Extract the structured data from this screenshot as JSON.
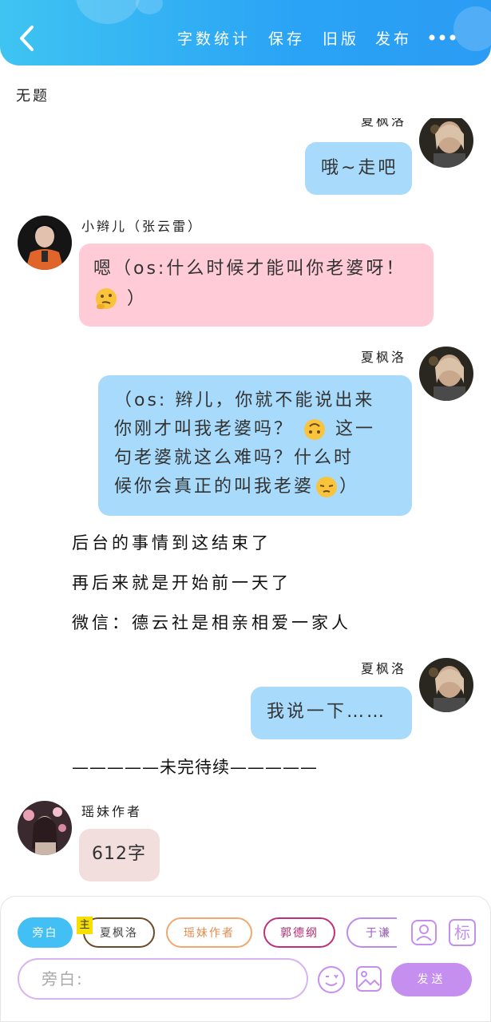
{
  "header": {
    "actions": [
      "字数统计",
      "保存",
      "旧版",
      "发布"
    ]
  },
  "doc": {
    "title": "无题"
  },
  "messages": {
    "m1": {
      "name": "夏枫洛",
      "text": "哦~走吧"
    },
    "m2": {
      "name": "小辫儿（张云雷）",
      "line1": "嗯（os:什么时候才能叫你老婆呀！",
      "line2": "）"
    },
    "m3": {
      "name": "夏枫洛",
      "lines": [
        "（os: 辫儿，你就不能说出来",
        "你刚才叫我老婆吗？",
        "这一",
        "句老婆就这么难吗？什么时",
        "候你会真正的叫我老婆",
        "）"
      ]
    },
    "narration": [
      "后台的事情到这结束了",
      "再后来就是开始前一天了",
      "微信：德云社是相亲相爱一家人"
    ],
    "m4": {
      "name": "夏枫洛",
      "text": "我说一下……"
    },
    "divider": "—————未完待续—————",
    "m5": {
      "name": "瑶妹作者",
      "text": "612字"
    }
  },
  "composer": {
    "chips": [
      "旁白",
      "夏枫洛",
      "瑶妹作者",
      "郭德纲",
      "于谦"
    ],
    "main_tag": "主",
    "input_placeholder": "旁白:",
    "send_label": "发送",
    "mark_label": "标"
  },
  "colors": {
    "header": "#2aa3f5",
    "blue_bubble": "#a8dbfb",
    "pink_bubble": "#ffcbd7",
    "send": "#c58ff0"
  }
}
